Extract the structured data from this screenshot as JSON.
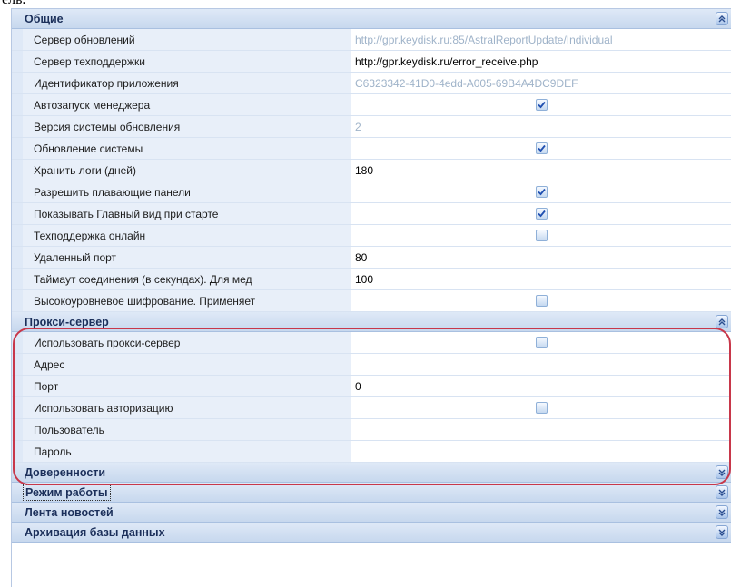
{
  "top_fragment": "ель.",
  "colors": {
    "header_bg": "#cfdff2",
    "header_text": "#1b2f5a",
    "name_bg": "#e8eff9",
    "highlight": "#c8374a",
    "check": "#1f4fb0"
  },
  "sections": [
    {
      "title": "Общие",
      "expanded": true,
      "toggle_icon": "chevron-up-icon",
      "rows": [
        {
          "name": "Сервер обновлений",
          "type": "text",
          "style": "gray",
          "value": "http://gpr.keydisk.ru:85/AstralReportUpdate/Individual"
        },
        {
          "name": "Сервер техподдержки",
          "type": "text",
          "style": "black",
          "value": "http://gpr.keydisk.ru/error_receive.php"
        },
        {
          "name": "Идентификатор приложения",
          "type": "text",
          "style": "gray",
          "value": "C6323342-41D0-4edd-A005-69B4A4DC9DEF"
        },
        {
          "name": "Автозапуск менеджера",
          "type": "checkbox",
          "checked": true
        },
        {
          "name": "Версия системы обновления",
          "type": "text",
          "style": "gray",
          "value": "2"
        },
        {
          "name": "Обновление системы",
          "type": "checkbox",
          "checked": true
        },
        {
          "name": "Хранить логи (дней)",
          "type": "text",
          "style": "black",
          "value": "180"
        },
        {
          "name": "Разрешить плавающие панели",
          "type": "checkbox",
          "checked": true
        },
        {
          "name": "Показывать Главный вид при старте",
          "type": "checkbox",
          "checked": true
        },
        {
          "name": "Техподдержка онлайн",
          "type": "checkbox",
          "checked": false
        },
        {
          "name": "Удаленный порт",
          "type": "text",
          "style": "black",
          "value": "80"
        },
        {
          "name": "Таймаут соединения (в секундах). Для мед",
          "type": "text",
          "style": "black",
          "value": "100"
        },
        {
          "name": "Высокоуровневое шифрование. Применяет",
          "type": "checkbox",
          "checked": false
        }
      ]
    },
    {
      "title": "Прокси-сервер",
      "expanded": true,
      "toggle_icon": "chevron-up-icon",
      "rows": [
        {
          "name": "Использовать прокси-сервер",
          "type": "checkbox",
          "checked": false
        },
        {
          "name": "Адрес",
          "type": "text",
          "style": "black",
          "value": ""
        },
        {
          "name": "Порт",
          "type": "text",
          "style": "black",
          "value": "0"
        },
        {
          "name": "Использовать авторизацию",
          "type": "checkbox",
          "checked": false
        },
        {
          "name": "Пользователь",
          "type": "text",
          "style": "black",
          "value": ""
        },
        {
          "name": "Пароль",
          "type": "text",
          "style": "black",
          "value": ""
        }
      ]
    },
    {
      "title": "Доверенности",
      "expanded": false,
      "toggle_icon": "chevron-down-icon",
      "rows": []
    },
    {
      "title": "Режим работы",
      "expanded": false,
      "focused": true,
      "toggle_icon": "chevron-down-icon",
      "rows": []
    },
    {
      "title": "Лента новостей",
      "expanded": false,
      "toggle_icon": "chevron-down-icon",
      "rows": []
    },
    {
      "title": "Архивация базы данных",
      "expanded": false,
      "toggle_icon": "chevron-down-icon",
      "rows": []
    }
  ]
}
